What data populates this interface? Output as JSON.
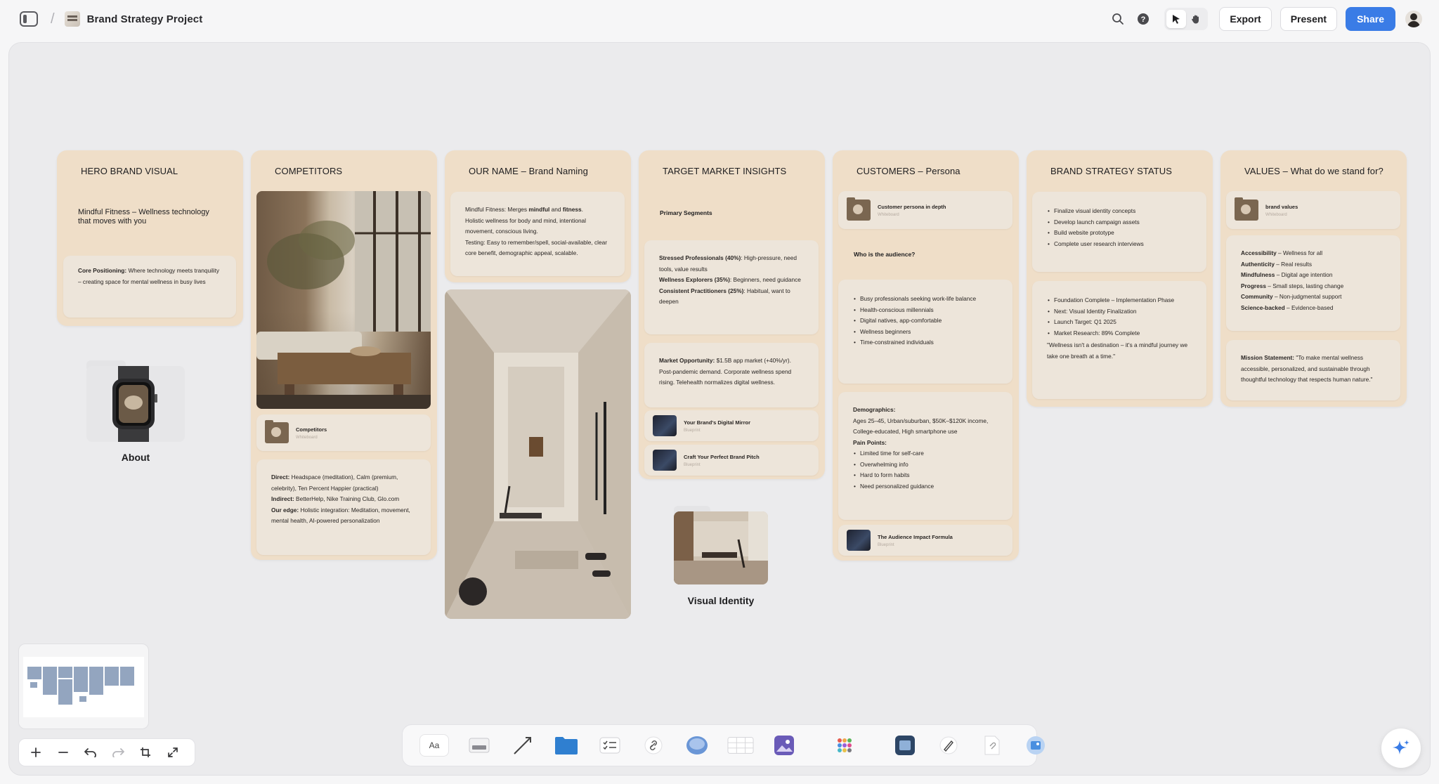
{
  "header": {
    "doc_title": "Brand Strategy Project",
    "export_label": "Export",
    "present_label": "Present",
    "share_label": "Share"
  },
  "boards": {
    "hero": {
      "title": "HERO BRAND VISUAL",
      "headline": "Mindful Fitness – Wellness technology that moves with you",
      "positioning_label": "Core Positioning:",
      "positioning_text": "Where technology meets tranquility – creating space for mental wellness in busy lives"
    },
    "about": {
      "label": "About"
    },
    "competitors": {
      "title": "COMPETITORS",
      "link_name": "Competitors",
      "link_sub": "Whiteboard",
      "direct_label": "Direct:",
      "direct_text": "Headspace (meditation), Calm (premium, celebrity), Ten Percent Happier (practical)",
      "indirect_label": "Indirect:",
      "indirect_text": "BetterHelp, Nike Training Club, Glo.com",
      "edge_label": "Our edge:",
      "edge_text": "Holistic integration: Meditation, movement, mental health, AI-powered personalization"
    },
    "naming": {
      "title": "OUR NAME – Brand Naming",
      "line1_a": "Mindful Fitness: Merges ",
      "line1_b": "mindful",
      "line1_c": " and ",
      "line1_d": "fitness",
      "line1_e": ".",
      "line2": "Holistic wellness for body and mind, intentional movement, conscious living.",
      "line3": "Testing: Easy to remember/spell, social-available, clear core benefit, demographic appeal, scalable."
    },
    "target": {
      "title": "TARGET MARKET INSIGHTS",
      "segments_label": "Primary Segments",
      "seg1_label": "Stressed Professionals (40%)",
      "seg1_text": ": High-pressure, need tools, value results",
      "seg2_label": "Wellness Explorers (35%)",
      "seg2_text": ": Beginners, need guidance",
      "seg3_label": "Consistent Practitioners (25%)",
      "seg3_text": ": Habitual, want to deepen",
      "opp_label": "Market Opportunity:",
      "opp_text": "$1.5B app market (+40%/yr). Post-pandemic demand. Corporate wellness spend rising. Telehealth normalizes digital wellness.",
      "link1_name": "Your Brand's Digital Mirror",
      "link1_sub": "Blueprint",
      "link2_name": "Craft Your Perfect Brand Pitch",
      "link2_sub": "Blueprint"
    },
    "visual_identity": {
      "label": "Visual Identity"
    },
    "customers": {
      "title": "CUSTOMERS – Persona",
      "link_name": "Customer persona in depth",
      "link_sub": "Whiteboard",
      "audience_q": "Who is the audience?",
      "audience": [
        "Busy professionals seeking work-life balance",
        "Health-conscious millennials",
        "Digital natives, app-comfortable",
        "Wellness beginners",
        "Time-constrained individuals"
      ],
      "demo_label": "Demographics:",
      "demo_text": "Ages 25–45, Urban/suburban, $50K–$120K income, College-educated, High smartphone use",
      "pain_label": "Pain Points:",
      "pains": [
        "Limited time for self-care",
        "Overwhelming info",
        "Hard to form habits",
        "Need personalized guidance"
      ],
      "formula_name": "The Audience Impact Formula",
      "formula_sub": "Blueprint"
    },
    "status": {
      "title": "BRAND STRATEGY STATUS",
      "todos": [
        "Finalize visual identity concepts",
        "Develop launch campaign assets",
        "Build website prototype",
        "Complete user research interviews"
      ],
      "progress": [
        "Foundation Complete – Implementation Phase",
        "Next: Visual Identity Finalization",
        "Launch Target: Q1 2025",
        "Market Research: 89% Complete"
      ],
      "quote": "\"Wellness isn't a destination – it's a mindful journey we take one breath at a time.\""
    },
    "values": {
      "title": "VALUES – What do we stand for?",
      "link_name": "brand values",
      "link_sub": "Whiteboard",
      "items": [
        {
          "label": "Accessibility",
          "text": " – Wellness for all"
        },
        {
          "label": "Authenticity",
          "text": " – Real results"
        },
        {
          "label": "Mindfulness",
          "text": " – Digital age intention"
        },
        {
          "label": "Progress",
          "text": " – Small steps, lasting change"
        },
        {
          "label": "Community",
          "text": " – Non-judgmental support"
        },
        {
          "label": "Science-backed",
          "text": " – Evidence-based"
        }
      ],
      "mission_label": "Mission Statement:",
      "mission_text": " \"To make mental wellness accessible, personalized, and sustainable through thoughtful technology that respects human nature.\""
    }
  },
  "toolbar": {
    "text_tool_label": "Aa"
  },
  "colors": {
    "board_bg": "#efdec8",
    "card_bg": "#ede5da",
    "accent": "#3a7ce6",
    "canvas_bg": "#ebebed"
  }
}
